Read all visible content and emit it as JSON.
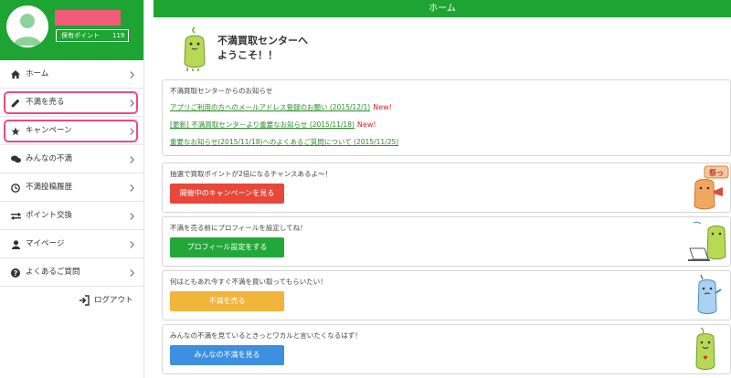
{
  "sidebar": {
    "points_label": "保有ポイント",
    "points_value": "119",
    "items": [
      {
        "label": "ホーム",
        "icon": "home-icon",
        "highlight": false
      },
      {
        "label": "不満を売る",
        "icon": "pencil-icon",
        "highlight": true
      },
      {
        "label": "キャンペーン",
        "icon": "star-icon",
        "highlight": true
      },
      {
        "label": "みんなの不満",
        "icon": "chat-bubbles-icon",
        "highlight": false
      },
      {
        "label": "不満投稿履歴",
        "icon": "clock-icon",
        "highlight": false
      },
      {
        "label": "ポイント交換",
        "icon": "exchange-arrows-icon",
        "highlight": false
      },
      {
        "label": "マイページ",
        "icon": "user-icon",
        "highlight": false
      },
      {
        "label": "よくあるご質問",
        "icon": "question-circle-icon",
        "highlight": false
      }
    ],
    "logout_label": "ログアウト"
  },
  "header": {
    "title": "ホーム"
  },
  "welcome": {
    "line1": "不満買取センターへ",
    "line2": "ようこそ！！"
  },
  "news": {
    "title": "不満買取センターからのお知らせ",
    "items": [
      {
        "text": "アプリご利用の方へのメールアドレス登録のお願い (2015/12/1)",
        "badge": "New!"
      },
      {
        "text": "[更新] 不満買取センターより重要なお知らせ (2015/11/18)",
        "badge": "New!"
      },
      {
        "text": "重要なお知らせ(2015/11/18)へのよくあるご質問について (2015/11/25)",
        "badge": ""
      }
    ]
  },
  "cards": [
    {
      "text": "抽選で買取ポイントが2倍になるチャンスあるよ～！",
      "button": "開催中のキャンペーンを見る",
      "color": "#e8473a",
      "illustration": "megaphone-mascot-illustration",
      "sticker_text": "祭っ"
    },
    {
      "text": "不満を売る前にプロフィールを設定してね！",
      "button": "プロフィール設定をする",
      "color": "#22a838",
      "illustration": "laptop-mascot-illustration"
    },
    {
      "text": "何はともあれ今すぐ不満を買い取ってもらいたい！",
      "button": "不満を売る",
      "color": "#f0b53a",
      "illustration": "blue-mascot-illustration"
    },
    {
      "text": "みんなの不満を見ているときっとワカルと言いたくなるはず！",
      "button": "みんなの不満を見る",
      "color": "#3d8fe0",
      "illustration": "green-mascot-illustration"
    }
  ]
}
